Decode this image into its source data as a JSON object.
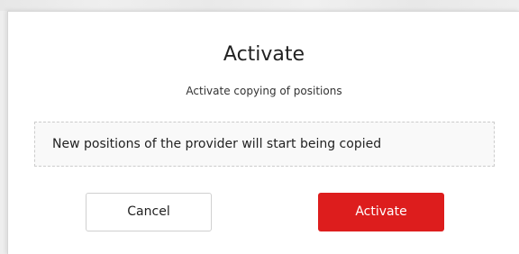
{
  "dialog": {
    "title": "Activate",
    "subtitle": "Activate copying of positions",
    "message": "New positions of the provider will start being copied",
    "cancel_label": "Cancel",
    "activate_label": "Activate"
  },
  "colors": {
    "accent": "#dd1d1d",
    "surface": "#ffffff",
    "backdrop": "#eeeeee"
  }
}
